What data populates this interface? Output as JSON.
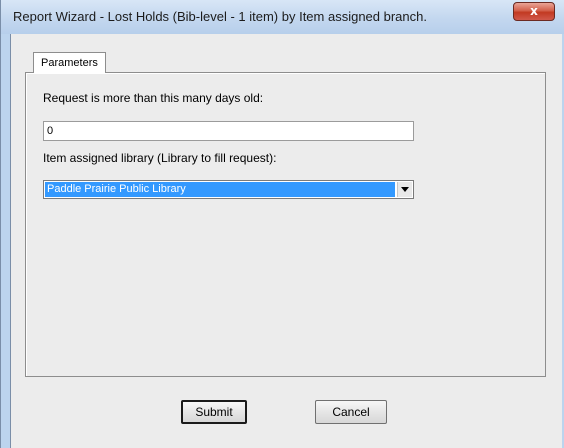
{
  "window": {
    "title": "Report Wizard - Lost Holds (Bib-level - 1 item) by Item assigned branch.",
    "close_symbol": "x"
  },
  "tabs": [
    {
      "label": "Parameters",
      "selected": true
    }
  ],
  "parameters": {
    "days_label": "Request is more than this many days old:",
    "days_value": "0",
    "library_label": "Item assigned library (Library to fill request):",
    "library_selected": "Paddle Prairie Public Library"
  },
  "buttons": {
    "submit_label": "Submit",
    "cancel_label": "Cancel"
  },
  "icons": {
    "close": "close-icon",
    "dropdown": "chevron-down-icon"
  },
  "colors": {
    "selection": "#3399ff",
    "close_button": "#c23a22",
    "window_frame": "#bcd4ee"
  }
}
